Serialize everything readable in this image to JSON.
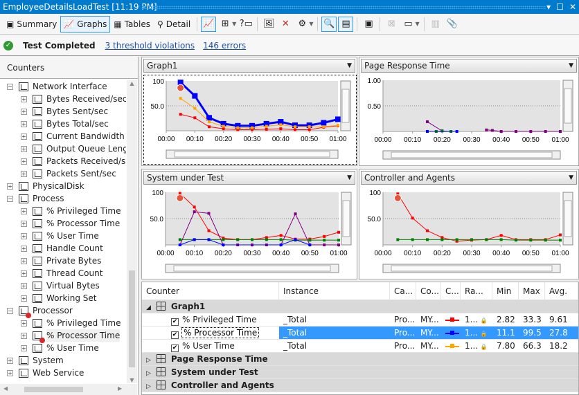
{
  "window": {
    "title": "EmployeeDetailsLoadTest [11:19 PM]",
    "controls": [
      "dropdown-icon",
      "maximize-icon",
      "close-icon"
    ]
  },
  "toolbar": {
    "summary_label": "Summary",
    "graphs_label": "Graphs",
    "tables_label": "Tables",
    "detail_label": "Detail"
  },
  "status": {
    "text": "Test Completed",
    "threshold_link": "3 threshold violations",
    "errors_link": "146 errors"
  },
  "counters": {
    "header": "Counters",
    "tree": [
      {
        "label": "Network Interface",
        "level": 0,
        "expanded": true,
        "error": false
      },
      {
        "label": "Bytes Received/sec",
        "level": 1,
        "expanded": false,
        "error": false
      },
      {
        "label": "Bytes Sent/sec",
        "level": 1,
        "expanded": false,
        "error": false
      },
      {
        "label": "Bytes Total/sec",
        "level": 1,
        "expanded": false,
        "error": false
      },
      {
        "label": "Current Bandwidth",
        "level": 1,
        "expanded": false,
        "error": false
      },
      {
        "label": "Output Queue Length",
        "level": 1,
        "expanded": false,
        "error": false
      },
      {
        "label": "Packets Received/sec",
        "level": 1,
        "expanded": false,
        "error": false
      },
      {
        "label": "Packets Sent/sec",
        "level": 1,
        "expanded": false,
        "error": false
      },
      {
        "label": "PhysicalDisk",
        "level": 0,
        "expanded": false,
        "error": false
      },
      {
        "label": "Process",
        "level": 0,
        "expanded": true,
        "error": false
      },
      {
        "label": "% Privileged Time",
        "level": 1,
        "expanded": false,
        "error": false
      },
      {
        "label": "% Processor Time",
        "level": 1,
        "expanded": false,
        "error": false
      },
      {
        "label": "% User Time",
        "level": 1,
        "expanded": false,
        "error": false
      },
      {
        "label": "Handle Count",
        "level": 1,
        "expanded": false,
        "error": false
      },
      {
        "label": "Private Bytes",
        "level": 1,
        "expanded": false,
        "error": false
      },
      {
        "label": "Thread Count",
        "level": 1,
        "expanded": false,
        "error": false
      },
      {
        "label": "Virtual Bytes",
        "level": 1,
        "expanded": false,
        "error": false
      },
      {
        "label": "Working Set",
        "level": 1,
        "expanded": false,
        "error": false
      },
      {
        "label": "Processor",
        "level": 0,
        "expanded": true,
        "error": true
      },
      {
        "label": "% Privileged Time",
        "level": 1,
        "expanded": false,
        "error": false
      },
      {
        "label": "% Processor Time",
        "level": 1,
        "expanded": false,
        "error": true
      },
      {
        "label": "% User Time",
        "level": 1,
        "expanded": false,
        "error": false
      },
      {
        "label": "System",
        "level": 0,
        "expanded": false,
        "error": false
      },
      {
        "label": "Web Service",
        "level": 0,
        "expanded": false,
        "error": false
      }
    ]
  },
  "chart_data": [
    {
      "type": "line",
      "title": "Graph1",
      "x": [
        "00:00",
        "00:10",
        "00:20",
        "00:30",
        "00:40",
        "00:50",
        "01:00"
      ],
      "ylim": [
        0,
        100
      ],
      "yticks": [
        "100",
        "50.0"
      ],
      "threshold_marker": {
        "x": 5,
        "y": 86
      },
      "series": [
        {
          "name": "% Privileged Time",
          "color": "#ff0000",
          "x": [
            5,
            10,
            15,
            20,
            25,
            30,
            35,
            40,
            45,
            50,
            55,
            60
          ],
          "values": [
            33,
            26,
            8,
            4,
            2,
            2,
            3,
            4,
            2,
            2,
            7,
            10
          ]
        },
        {
          "name": "% Processor Time",
          "color": "#0000ff",
          "bold": true,
          "x": [
            5,
            10,
            15,
            20,
            25,
            30,
            35,
            40,
            45,
            50,
            55,
            60
          ],
          "values": [
            97,
            70,
            26,
            14,
            10,
            10,
            14,
            18,
            11,
            11,
            16,
            23
          ]
        },
        {
          "name": "% User Time",
          "color": "#ffa500",
          "x": [
            5,
            10,
            15,
            20,
            25,
            30,
            35,
            40,
            45,
            50,
            55,
            60
          ],
          "values": [
            65,
            45,
            18,
            9,
            6,
            6,
            9,
            12,
            8,
            8,
            8,
            11
          ]
        }
      ]
    },
    {
      "type": "line",
      "title": "Page Response Time",
      "x": [
        "00:00",
        "00:10",
        "00:20",
        "00:30",
        "00:40",
        "00:50",
        "01:00"
      ],
      "ylim": [
        0,
        1.0
      ],
      "yticks": [
        "1.00",
        "0.50"
      ],
      "series": [
        {
          "name": "purple",
          "color": "#800080",
          "x": [
            15,
            20
          ],
          "values": [
            0.19,
            0.01
          ]
        },
        {
          "name": "purple-2",
          "color": "#800080",
          "x": [
            35,
            37,
            40,
            45,
            50,
            55,
            60
          ],
          "values": [
            0.03,
            0.02,
            0.0,
            0.0,
            0.0,
            0.0,
            0.0
          ]
        },
        {
          "name": "green",
          "color": "#008000",
          "x": [
            18,
            20,
            23
          ],
          "values": [
            0.0,
            0.01,
            0.0
          ]
        },
        {
          "name": "blue",
          "color": "#0000ff",
          "x": [
            15,
            25
          ],
          "values": [
            0.0,
            0.0
          ]
        }
      ]
    },
    {
      "type": "line",
      "title": "System under Test",
      "x": [
        "00:00",
        "00:10",
        "00:20",
        "00:30",
        "00:40",
        "00:50",
        "01:00"
      ],
      "ylim": [
        0,
        100
      ],
      "yticks": [
        "100",
        "50.0"
      ],
      "threshold_marker": {
        "x": 5,
        "y": 89
      },
      "series": [
        {
          "name": "red",
          "color": "#ff0000",
          "x": [
            5,
            10,
            15,
            20,
            25,
            30,
            35,
            40,
            45,
            50,
            55,
            60
          ],
          "values": [
            98,
            72,
            27,
            13,
            10,
            10,
            14,
            18,
            11,
            11,
            16,
            24
          ]
        },
        {
          "name": "purple",
          "color": "#800080",
          "x": [
            5,
            10,
            15,
            20,
            25,
            30,
            35,
            40,
            45,
            50,
            55,
            60
          ],
          "values": [
            0,
            63,
            60,
            0,
            0,
            0,
            0,
            0,
            59,
            0,
            0,
            0
          ]
        },
        {
          "name": "green",
          "color": "#008000",
          "x": [
            5,
            10,
            15,
            20,
            25,
            30,
            35,
            40,
            45,
            50,
            55,
            60
          ],
          "values": [
            10,
            10,
            10,
            10,
            10,
            10,
            10,
            10,
            9,
            9,
            9,
            9
          ]
        },
        {
          "name": "blue",
          "color": "#0000ff",
          "x": [
            5,
            10,
            15,
            20,
            40,
            45,
            50
          ],
          "values": [
            0,
            10,
            10,
            0,
            0,
            10,
            0
          ]
        }
      ]
    },
    {
      "type": "line",
      "title": "Controller and Agents",
      "x": [
        "00:00",
        "00:10",
        "00:20",
        "00:30",
        "00:40",
        "00:50",
        "01:00"
      ],
      "ylim": [
        0,
        100
      ],
      "yticks": [
        "100",
        "50.0"
      ],
      "threshold_marker": {
        "x": 5,
        "y": 89
      },
      "series": [
        {
          "name": "red",
          "color": "#ff0000",
          "x": [
            5,
            10,
            15,
            20,
            25,
            30,
            35,
            40,
            45,
            50,
            55,
            60
          ],
          "values": [
            97,
            51,
            27,
            14,
            7,
            9,
            10,
            18,
            10,
            10,
            10,
            19
          ]
        },
        {
          "name": "green",
          "color": "#008000",
          "x": [
            5,
            10,
            15,
            20,
            25,
            30,
            35,
            40,
            45,
            50,
            55,
            60
          ],
          "values": [
            10,
            10,
            10,
            10,
            10,
            10,
            10,
            10,
            9,
            9,
            9,
            9
          ]
        }
      ]
    }
  ],
  "grid": {
    "columns": [
      "Counter",
      "Instance",
      "Ca...",
      "Co...",
      "C...",
      "Ra...",
      "Min",
      "Max",
      "Avg."
    ],
    "groups": [
      {
        "name": "Graph1",
        "expanded": true,
        "rows": [
          {
            "counter": "% Privileged Time",
            "instance": "_Total",
            "category": "Pro...",
            "computer": "MY...",
            "color": "#ff0000",
            "range": "1...",
            "min": "2.82",
            "max": "33.3",
            "avg": "9.61",
            "checked": true,
            "selected": false
          },
          {
            "counter": "% Processor Time",
            "instance": "_Total",
            "category": "Pro...",
            "computer": "MY...",
            "color": "#0000ff",
            "range": "1...",
            "min": "11.1",
            "max": "99.5",
            "avg": "27.8",
            "checked": true,
            "selected": true
          },
          {
            "counter": "% User Time",
            "instance": "_Total",
            "category": "Pro...",
            "computer": "MY...",
            "color": "#ffa500",
            "range": "1...",
            "min": "7.80",
            "max": "66.3",
            "avg": "18.2",
            "checked": true,
            "selected": false
          }
        ]
      },
      {
        "name": "Page Response Time",
        "expanded": false,
        "rows": []
      },
      {
        "name": "System under Test",
        "expanded": false,
        "rows": []
      },
      {
        "name": "Controller and Agents",
        "expanded": false,
        "rows": []
      }
    ]
  }
}
